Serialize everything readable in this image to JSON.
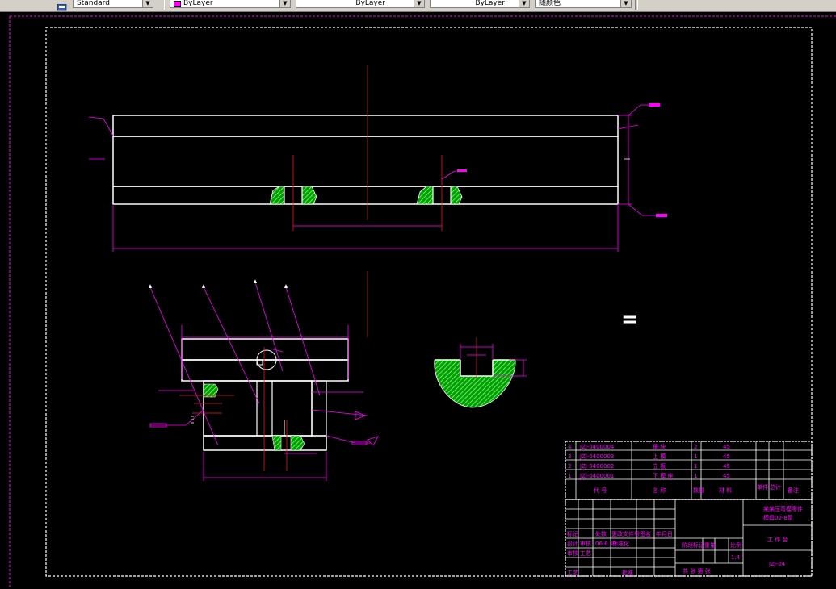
{
  "toolbar": {
    "text_style": "Standard",
    "layer_color": "ByLayer",
    "linetype": "ByLayer",
    "lineweight": "ByLayer",
    "plot_style": "随颜色"
  },
  "drawing": {
    "equals_sign": "=",
    "bom": {
      "rows": [
        {
          "no": "4",
          "code": "JZJ-0400004",
          "name": "镶 块",
          "qty": "2",
          "material": "45"
        },
        {
          "no": "3",
          "code": "JZJ-0400003",
          "name": "上 模",
          "qty": "1",
          "material": "45"
        },
        {
          "no": "2",
          "code": "JZJ-0400002",
          "name": "立 板",
          "qty": "1",
          "material": "45"
        },
        {
          "no": "1",
          "code": "JZJ-0400001",
          "name": "下 模 座",
          "qty": "1",
          "material": "45"
        }
      ],
      "header": {
        "code": "代 号",
        "name": "名 称",
        "qty": "数量",
        "material": "材 料",
        "unit_wt": "单件",
        "total_wt": "总计",
        "remark": "备注"
      }
    },
    "title_block": {
      "title_line1": "某某压弯模零件",
      "title_line2": "模具02-8系",
      "assembly": "工 作 台",
      "drawing_no": "JZJ-04",
      "scale": "1:4",
      "date": "06.6.12",
      "stage_mark": "阶段标记",
      "weight": "重量",
      "scale_label": "比例",
      "sheets": "共  张  第  张",
      "sign_row": [
        "标记",
        "处数",
        "更改文件号",
        "签名",
        "年月日"
      ],
      "designer_row": [
        "设计",
        "审核",
        "06.6.12",
        "标准化"
      ],
      "review_row": [
        "审核",
        "工艺"
      ],
      "approve_row": [
        "工艺",
        "批准"
      ]
    }
  }
}
